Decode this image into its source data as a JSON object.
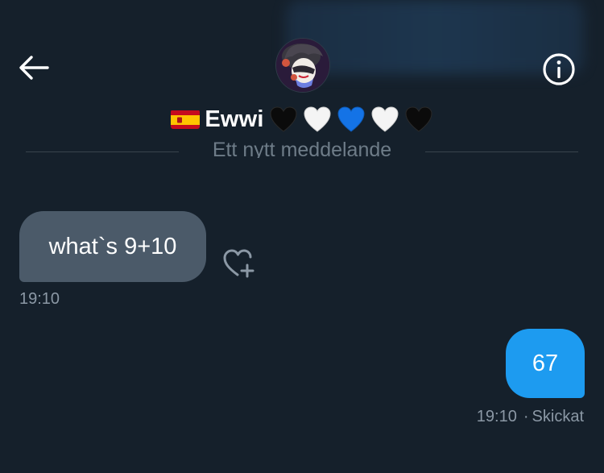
{
  "header": {
    "contact_name": "Ewwi",
    "flag_icon": "spain-flag-icon",
    "name_hearts": [
      "black-heart-icon",
      "white-heart-icon",
      "blue-heart-icon",
      "white-heart-icon",
      "black-heart-icon"
    ]
  },
  "divider": {
    "label": "Ett nytt meddelande"
  },
  "messages": [
    {
      "direction": "incoming",
      "text": "what`s 9+10",
      "time": "19:10"
    },
    {
      "direction": "outgoing",
      "text": "67",
      "time": "19:10",
      "status": "Skickat"
    }
  ],
  "colors": {
    "background": "#15202b",
    "incoming_bubble": "#4b5a69",
    "outgoing_bubble": "#1d9bf0",
    "muted_text": "#8b98a5"
  }
}
